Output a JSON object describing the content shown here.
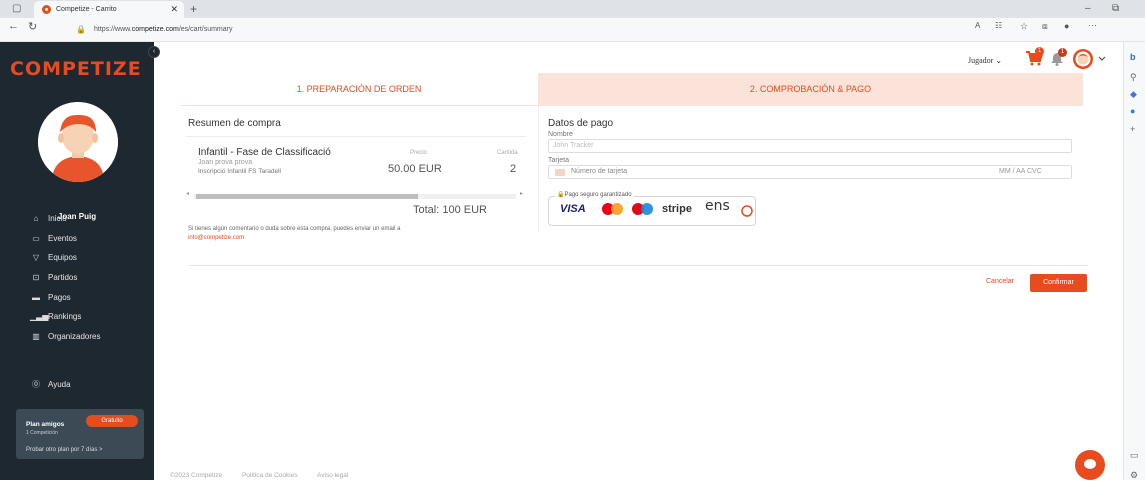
{
  "browser": {
    "tab_title": "Competize - Carrito",
    "url_prefix": "https://www.",
    "url_domain": "competize.com",
    "url_path": "/es/cart/summary"
  },
  "sidebar": {
    "logo": "COMPETIZE",
    "username": "Joan Puig",
    "items": [
      {
        "label": "Inicio",
        "icon": "home-icon"
      },
      {
        "label": "Eventos",
        "icon": "calendar-icon"
      },
      {
        "label": "Equipos",
        "icon": "shield-icon"
      },
      {
        "label": "Partidos",
        "icon": "versus-icon"
      },
      {
        "label": "Pagos",
        "icon": "card-icon"
      },
      {
        "label": "Rankings",
        "icon": "bar-chart-icon"
      },
      {
        "label": "Organizadores",
        "icon": "building-icon"
      }
    ],
    "help": "Ayuda",
    "plan": {
      "title": "Plan amigos",
      "badge": "Gratuito",
      "subtitle": "1 Competición",
      "try_link": "Probar otro plan por 7 días  >"
    }
  },
  "header": {
    "user_menu": "Jugador",
    "cart_count": "1",
    "notif_count": "1"
  },
  "steps": {
    "step1": "1. PREPARACIÓN DE ORDEN",
    "step2": "2. COMPROBACIÓN & PAGO"
  },
  "summary": {
    "title": "Resumen de compra",
    "product_name": "Infantil - Fase de Classificació",
    "product_sub1": "Joan prova prova",
    "product_sub2": "Inscripció Infantil FS Taradell",
    "col_price": "Precio",
    "col_qty": "Cantida",
    "price": "50.00 EUR",
    "qty": "2",
    "total": "Total: 100 EUR",
    "comment": "Si tienes algún comentario o duda sobre esta compra, puedes enviar un email a",
    "email": "info@competize.com"
  },
  "payment": {
    "title": "Datos de pago",
    "name_label": "Nombre",
    "name_placeholder": "John Tracker",
    "card_label": "Tarjeta",
    "card_placeholder": "Número de tarjeta",
    "card_exp": "MM / AA  CVC",
    "secure_label": "Pago seguro garantizado",
    "logos": [
      "VISA",
      "stripe",
      "ens"
    ]
  },
  "actions": {
    "cancel": "Cancelar",
    "confirm": "Confirmar"
  },
  "footer": {
    "copyright": "©2023 Competize",
    "cookies": "Política de Cookies",
    "legal": "Aviso legal"
  },
  "colors": {
    "brand": "#e84b1e",
    "sidebar_bg": "#1d2830",
    "step_active_bg": "#fbe3da"
  }
}
